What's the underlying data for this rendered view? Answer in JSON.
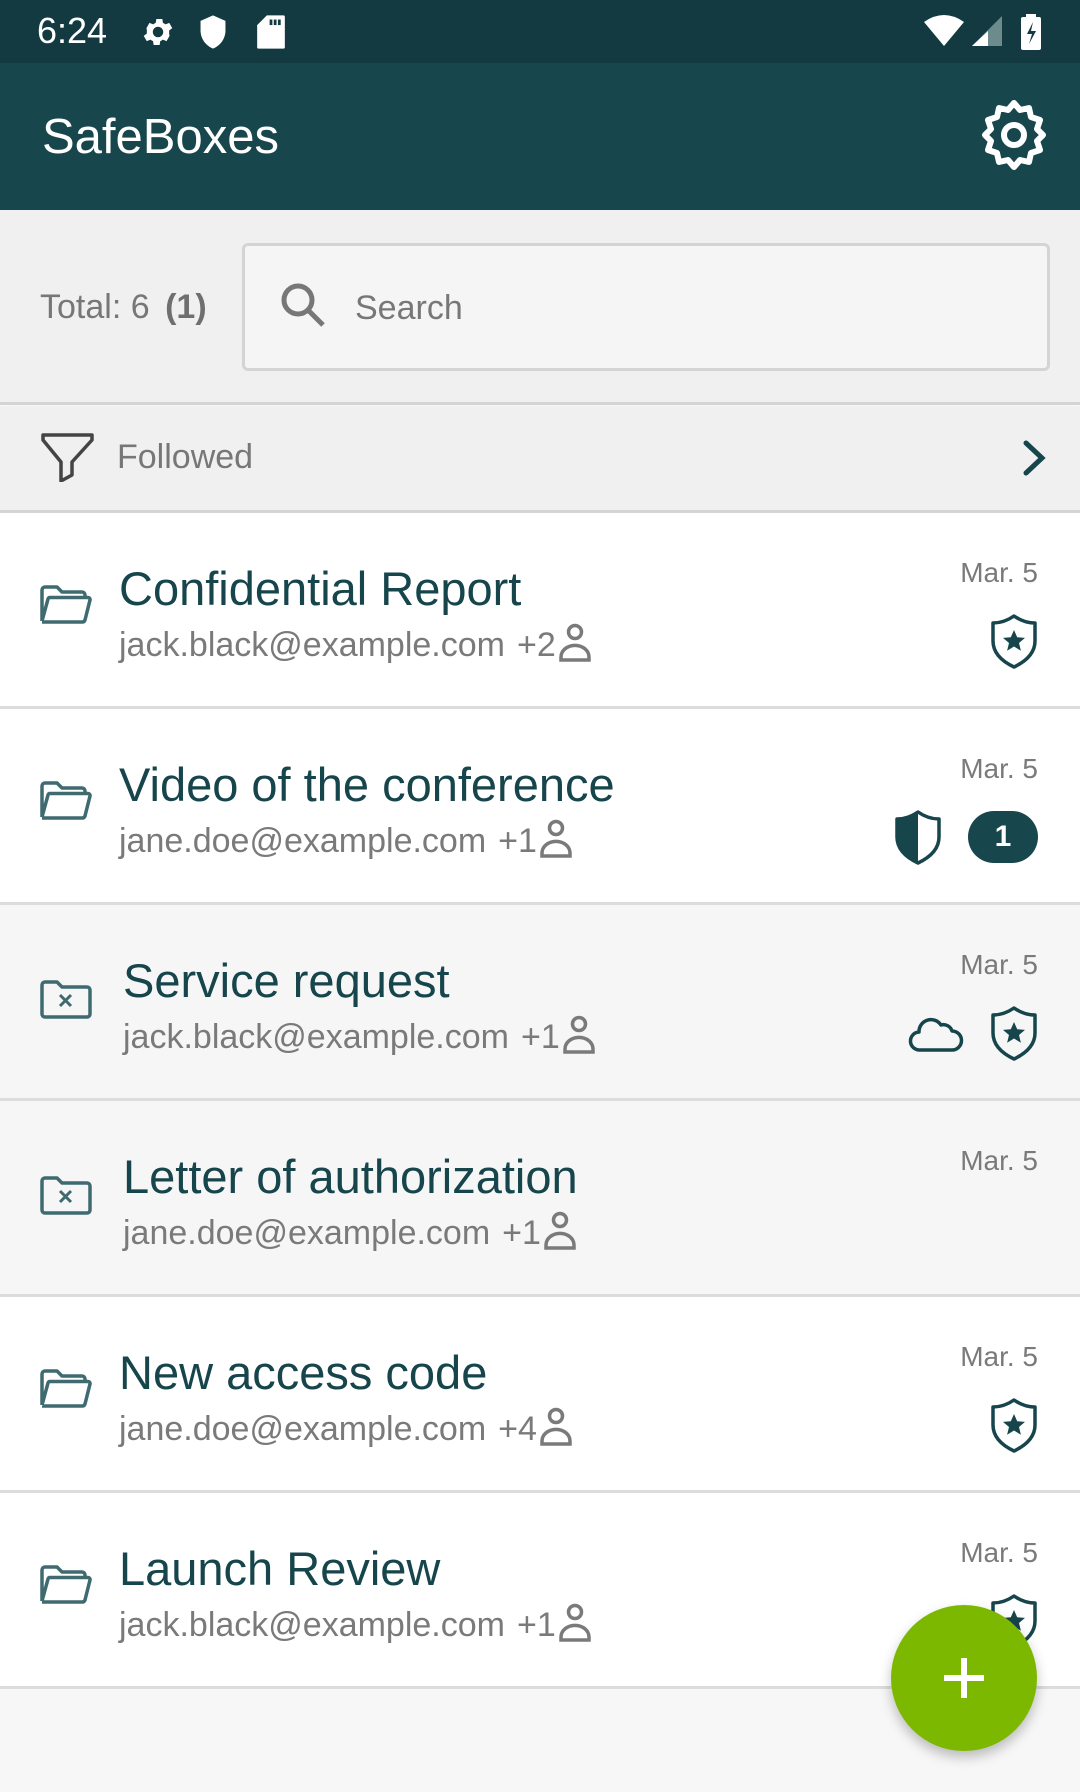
{
  "status_bar": {
    "time": "6:24",
    "left_icons": [
      "gear-icon",
      "shield-icon",
      "sd-card-icon"
    ],
    "right_icons": [
      "wifi-icon",
      "cellular-signal-icon",
      "battery-charging-icon"
    ]
  },
  "app_bar": {
    "title": "SafeBoxes",
    "settings_icon": "gear-outline-icon"
  },
  "summary": {
    "total_label": "Total:",
    "total_count": "6",
    "unread_count": "(1)"
  },
  "search": {
    "placeholder": "Search",
    "value": ""
  },
  "filter": {
    "label": "Followed",
    "icon": "filter-icon",
    "chevron": "chevron-right-icon"
  },
  "colors": {
    "primary_dark": "#123a40",
    "primary": "#17474d",
    "accent": "#7cb800",
    "text_secondary": "#7a7a7a"
  },
  "safeboxes": [
    {
      "title": "Confidential Report",
      "owner": "jack.black@example.com",
      "participants_extra": "+2",
      "date": "Mar. 5",
      "status": "open",
      "badges": [
        "shield-star-icon"
      ],
      "unread": null
    },
    {
      "title": "Video of the conference",
      "owner": "jane.doe@example.com",
      "participants_extra": "+1",
      "date": "Mar. 5",
      "status": "open",
      "badges": [
        "shield-half-icon"
      ],
      "unread": "1"
    },
    {
      "title": "Service request",
      "owner": "jack.black@example.com",
      "participants_extra": "+1",
      "date": "Mar. 5",
      "status": "closed",
      "badges": [
        "cloud-icon",
        "shield-star-icon"
      ],
      "unread": null
    },
    {
      "title": "Letter of authorization",
      "owner": "jane.doe@example.com",
      "participants_extra": "+1",
      "date": "Mar. 5",
      "status": "closed",
      "badges": [],
      "unread": null
    },
    {
      "title": "New access code",
      "owner": "jane.doe@example.com",
      "participants_extra": "+4",
      "date": "Mar. 5",
      "status": "open",
      "badges": [
        "shield-star-icon"
      ],
      "unread": null
    },
    {
      "title": "Launch Review",
      "owner": "jack.black@example.com",
      "participants_extra": "+1",
      "date": "Mar. 5",
      "status": "open",
      "badges": [
        "shield-star-icon"
      ],
      "unread": null
    }
  ],
  "fab": {
    "icon": "plus-icon",
    "action": "new-safebox"
  }
}
